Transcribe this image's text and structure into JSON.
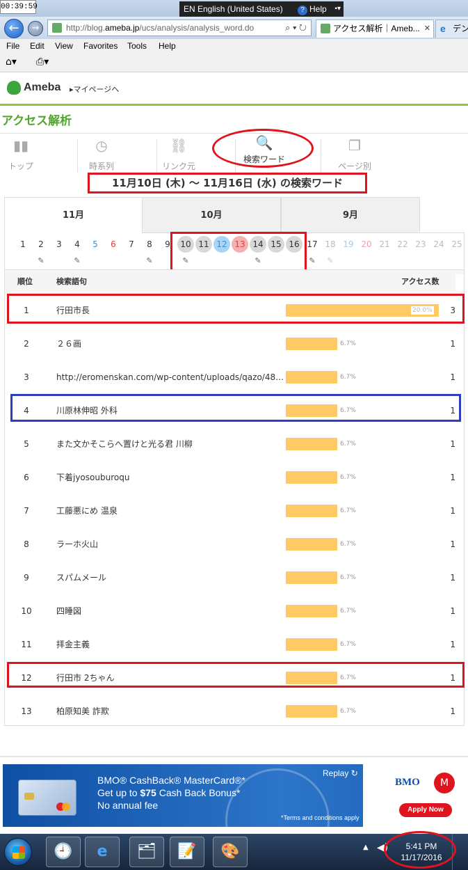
{
  "titlebar": {
    "clock": "00:39:59",
    "language": "EN English (United States)",
    "help": "Help"
  },
  "browser": {
    "url_prefix": "http://blog.",
    "url_host": "ameba.jp",
    "url_path": "/ucs/analysis/analysis_word.do",
    "tab_active": "アクセス解析｜Ameb...",
    "tab_other": "デン",
    "menu": [
      "File",
      "Edit",
      "View",
      "Favorites",
      "Tools",
      "Help"
    ]
  },
  "header": {
    "logo": "Ameba",
    "mypage": "▸マイページへ"
  },
  "page": {
    "title": "アクセス解析"
  },
  "nav": [
    {
      "label": "トップ",
      "icon": "bar-chart-icon"
    },
    {
      "label": "時系列",
      "icon": "clock-icon"
    },
    {
      "label": "リンク元",
      "icon": "link-icon"
    },
    {
      "label": "検索ワード",
      "icon": "search-icon"
    },
    {
      "label": "ページ別",
      "icon": "pages-icon"
    }
  ],
  "period": "11月10日 (木) ～ 11月16日 (水) の検索ワード",
  "months": [
    "11月",
    "10月",
    "9月"
  ],
  "days": [
    "1",
    "2",
    "3",
    "4",
    "5",
    "6",
    "7",
    "8",
    "9",
    "10",
    "11",
    "12",
    "13",
    "14",
    "15",
    "16",
    "17",
    "18",
    "19",
    "20",
    "21",
    "22",
    "23",
    "24",
    "25"
  ],
  "table": {
    "headers": {
      "rank": "順位",
      "term": "検索語句",
      "access": "アクセス数"
    },
    "rows": [
      {
        "rank": "1",
        "term": "行田市長",
        "pct": "20.0%",
        "share": 0.2,
        "count": "3"
      },
      {
        "rank": "2",
        "term": "２６画",
        "pct": "6.7%",
        "share": 0.067,
        "count": "1"
      },
      {
        "rank": "3",
        "term": "http://eromenskan.com/wp-content/uploads/qazo/48…",
        "pct": "6.7%",
        "share": 0.067,
        "count": "1"
      },
      {
        "rank": "4",
        "term": "川原林伸昭 外科",
        "pct": "6.7%",
        "share": 0.067,
        "count": "1"
      },
      {
        "rank": "5",
        "term": "また文かそこらへ置けと光る君 川柳",
        "pct": "6.7%",
        "share": 0.067,
        "count": "1"
      },
      {
        "rank": "6",
        "term": "下着jyosouburoqu",
        "pct": "6.7%",
        "share": 0.067,
        "count": "1"
      },
      {
        "rank": "7",
        "term": "工藤悪にめ 温泉",
        "pct": "6.7%",
        "share": 0.067,
        "count": "1"
      },
      {
        "rank": "8",
        "term": "ラーホ火山",
        "pct": "6.7%",
        "share": 0.067,
        "count": "1"
      },
      {
        "rank": "9",
        "term": "スパムメール",
        "pct": "6.7%",
        "share": 0.067,
        "count": "1"
      },
      {
        "rank": "10",
        "term": "四睡図",
        "pct": "6.7%",
        "share": 0.067,
        "count": "1"
      },
      {
        "rank": "11",
        "term": "拝金主義",
        "pct": "6.7%",
        "share": 0.067,
        "count": "1"
      },
      {
        "rank": "12",
        "term": "行田市 2ちゃん",
        "pct": "6.7%",
        "share": 0.067,
        "count": "1"
      },
      {
        "rank": "13",
        "term": "柏原知美 詐欺",
        "pct": "6.7%",
        "share": 0.067,
        "count": "1"
      }
    ]
  },
  "ad": {
    "title": "BMO® CashBack® MasterCard®*",
    "line2_pre": "Get up to ",
    "line2_bold": "$75",
    "line2_post": " Cash Back Bonus*",
    "line3": "No annual fee",
    "replay": "Replay ↻",
    "terms": "*Terms and conditions apply",
    "brand": "BMO",
    "cta": "Apply Now"
  },
  "taskbar": {
    "time": "5:41 PM",
    "date": "11/17/2016"
  }
}
